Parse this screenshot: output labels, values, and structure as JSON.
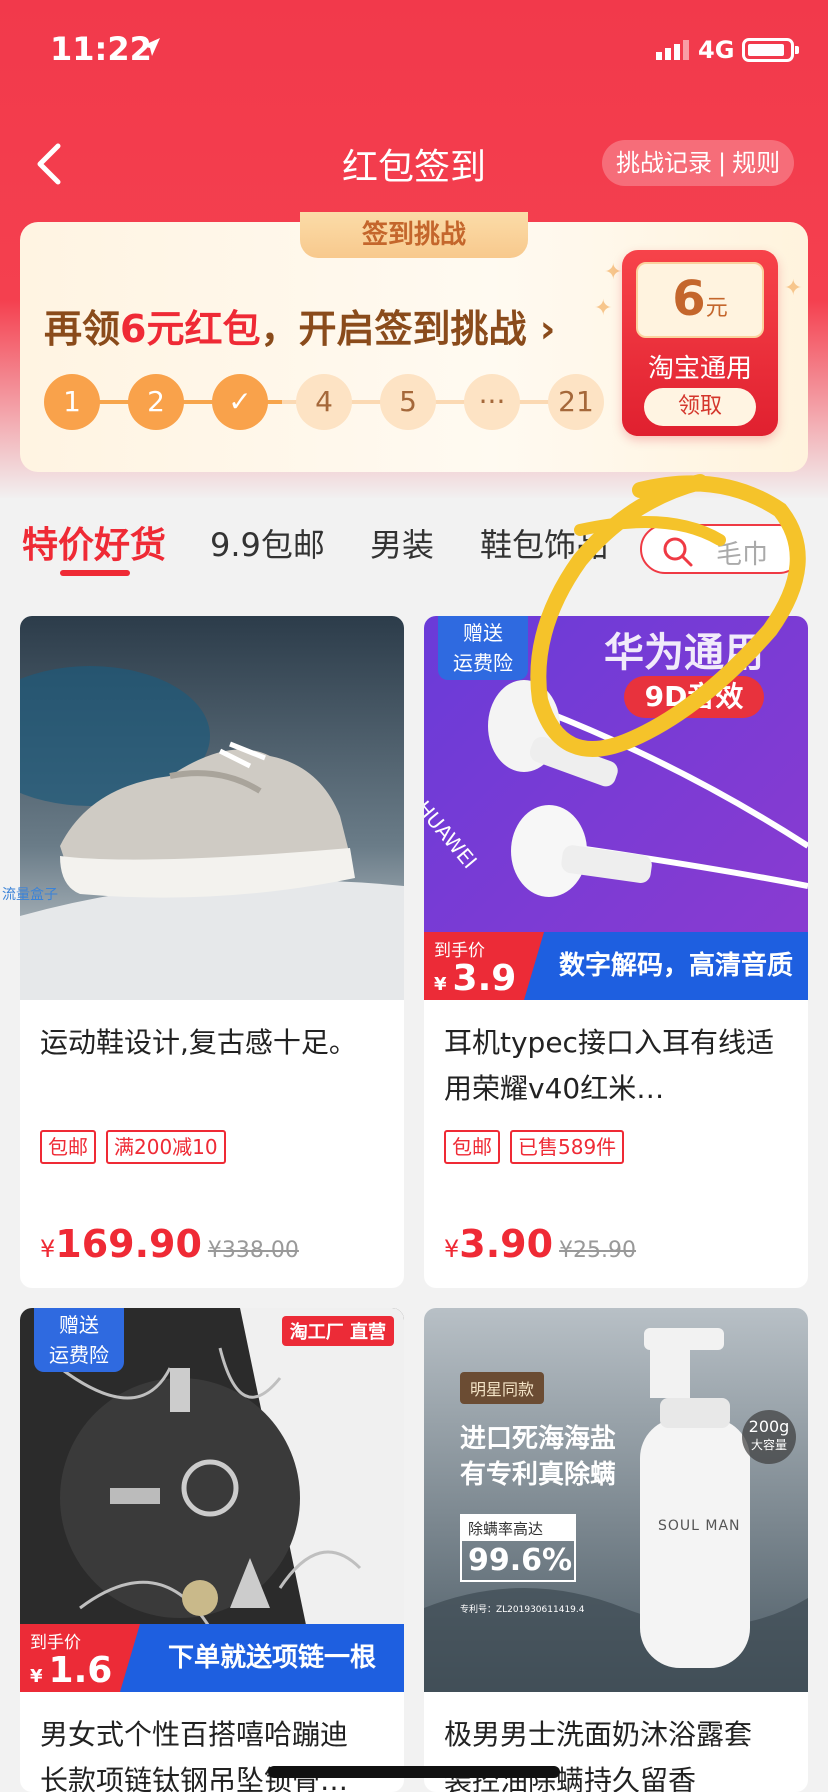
{
  "status_bar": {
    "time": "11:22",
    "network": "4G"
  },
  "nav": {
    "title": "红包签到",
    "records": "挑战记录",
    "separator": "|",
    "rules": "规则"
  },
  "sign_card": {
    "tab": "签到挑战",
    "headline_pre": "再领",
    "headline_highlight": "6元红包",
    "headline_post": "，开启签到挑战",
    "headline_arrow": "›",
    "steps": [
      "1",
      "2",
      "✓",
      "4",
      "5",
      "···",
      "21"
    ],
    "completed_steps": 3,
    "coupon": {
      "amount": "6",
      "unit": "元",
      "label": "淘宝通用",
      "button": "领取"
    }
  },
  "tabs": [
    "特价好货",
    "9.9包邮",
    "男装",
    "鞋包饰品"
  ],
  "search": {
    "placeholder": "毛巾"
  },
  "products": [
    {
      "title": "运动鞋设计,复古感十足。",
      "tags": [
        "包邮",
        "满200减10"
      ],
      "currency": "¥",
      "price": "169.90",
      "original_price": "¥338.00"
    },
    {
      "title": "耳机typec接口入耳有线适用荣耀v40红米…",
      "tags": [
        "包邮",
        "已售589件"
      ],
      "currency": "¥",
      "price": "3.90",
      "original_price": "¥25.90",
      "image_badge": [
        "赠送",
        "运费险"
      ],
      "image_texts": {
        "brand": "HUAWEI",
        "top": "华为通用",
        "pill": "9D音效",
        "arrive_label": "到手价",
        "arrive_price": "3.9",
        "arrive_currency": "¥",
        "slogan": "数字解码，高清音质"
      }
    },
    {
      "title": "男女式个性百搭嘻哈蹦迪长款项链钛钢吊坠锁骨…",
      "image_badge": [
        "赠送",
        "运费险"
      ],
      "image_texts": {
        "corner": "淘工厂 直营",
        "arrive_label": "到手价",
        "arrive_price": "1.6",
        "arrive_currency": "¥",
        "slogan": "下单就送项链一根"
      }
    },
    {
      "title": "极男男士洗面奶沐浴露套装控油除螨持久留香",
      "image_texts": {
        "star": "明星同款",
        "line1": "进口死海海盐",
        "line2": "有专利真除螨",
        "rate_label": "除螨率高达",
        "rate": "99.6%",
        "patent": "专利号：ZL201930611419.4",
        "brand": "SOUL MAN",
        "volume": "200g",
        "volume_label": "大容量"
      }
    }
  ],
  "watermark": "流量盒子",
  "colors": {
    "primary": "#ef2a35",
    "header": "#f2394b",
    "badge_blue": "#2f6ae0",
    "annotation": "#f5c32a"
  }
}
